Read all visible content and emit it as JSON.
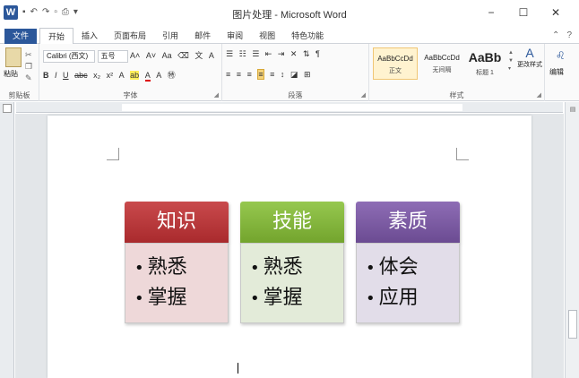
{
  "window": {
    "title": "图片处理 - Microsoft Word",
    "app_logo": "W",
    "controls": {
      "minimize": "−",
      "maximize": "☐",
      "close": "✕"
    }
  },
  "quick_access": {
    "icons": [
      "save-icon",
      "undo-icon",
      "redo-icon",
      "new-icon",
      "print-icon",
      "customize-icon"
    ]
  },
  "tabs": {
    "file": "文件",
    "items": [
      "开始",
      "插入",
      "页面布局",
      "引用",
      "邮件",
      "审阅",
      "视图",
      "特色功能"
    ],
    "active": "开始"
  },
  "ribbon": {
    "clipboard": {
      "label": "剪贴板",
      "paste": "粘贴"
    },
    "font": {
      "label": "字体",
      "font_name": "Calibri (西文)",
      "font_size": "五号"
    },
    "paragraph": {
      "label": "段落"
    },
    "styles": {
      "label": "样式",
      "items": [
        {
          "sample": "AaBbCcDd",
          "name": "正文"
        },
        {
          "sample": "AaBbCcDd",
          "name": "无间隔"
        },
        {
          "sample": "AaBb",
          "name": "标题 1"
        }
      ],
      "change_styles": "更改样式"
    },
    "editing": {
      "label": "编辑"
    }
  },
  "document": {
    "cards": [
      {
        "title": "知识",
        "items": [
          "熟悉",
          "掌握"
        ],
        "color": "#b83a3c"
      },
      {
        "title": "技能",
        "items": [
          "熟悉",
          "掌握"
        ],
        "color": "#84b63e"
      },
      {
        "title": "素质",
        "items": [
          "体会",
          "应用"
        ],
        "color": "#7c5ca4"
      }
    ]
  }
}
